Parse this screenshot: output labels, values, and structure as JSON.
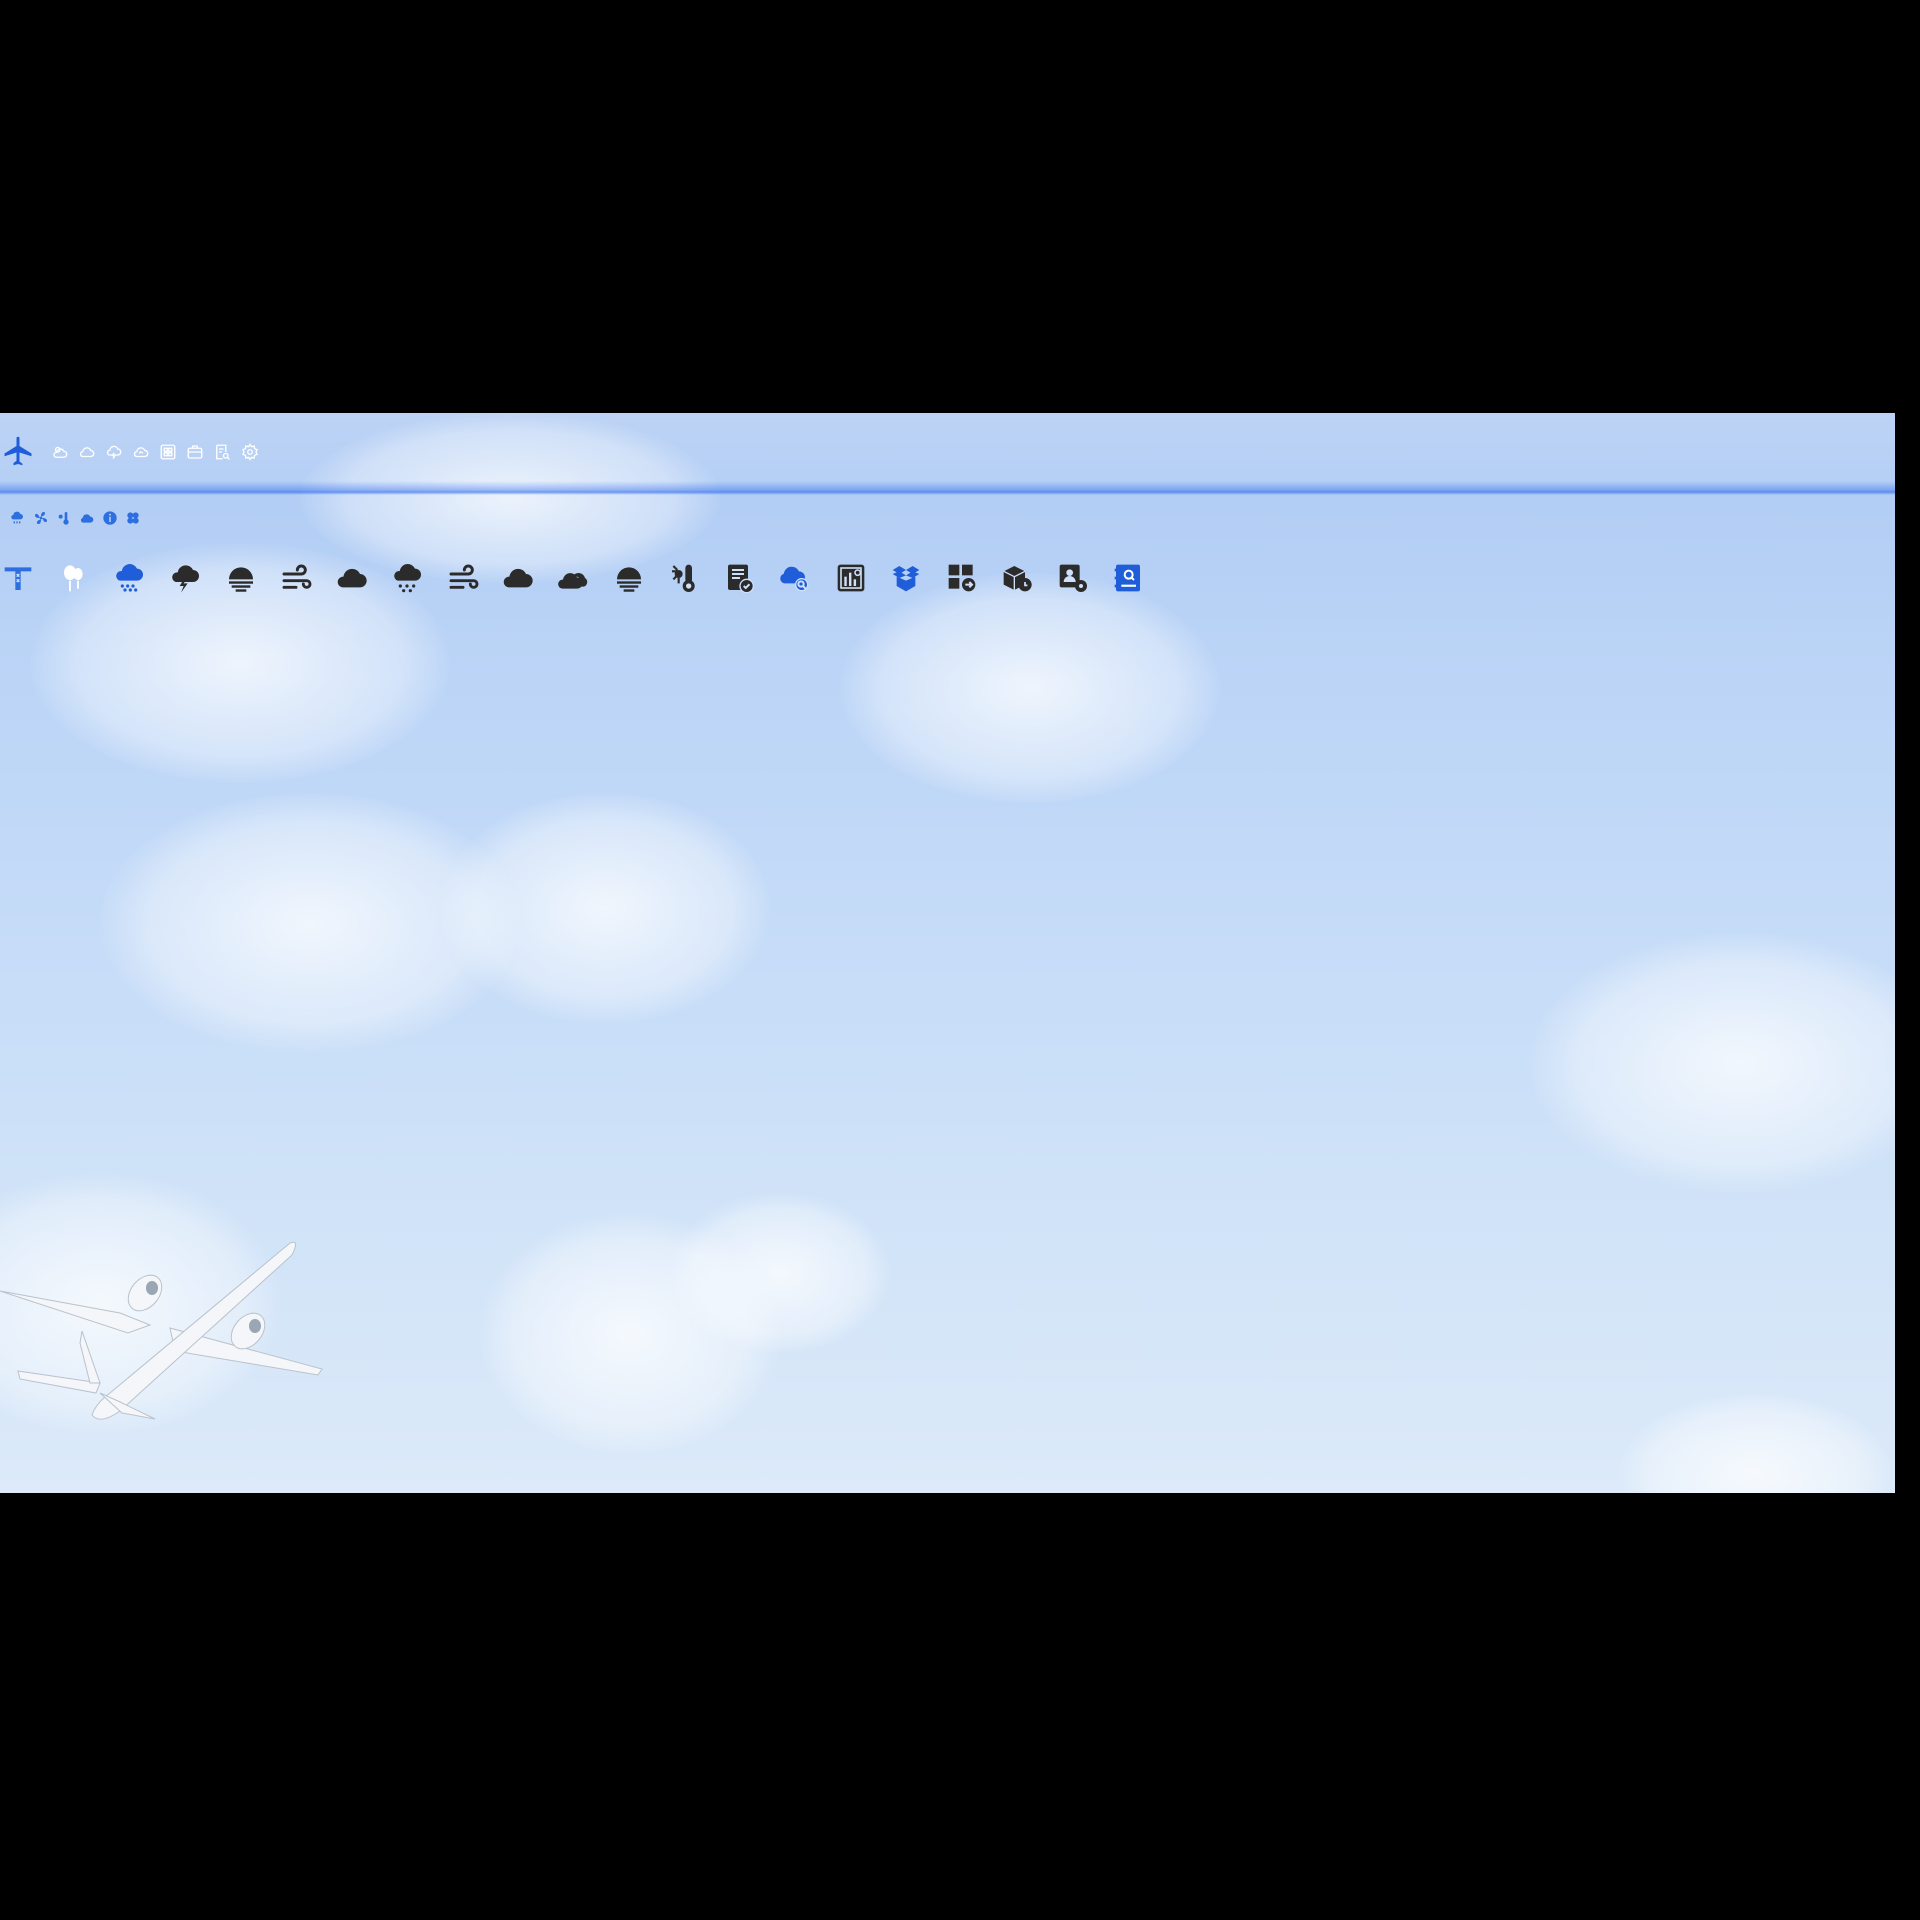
{
  "colors": {
    "accent_blue": "#1f5ed8",
    "toolbar_icon": "#ffffff",
    "dark_icon": "#2b2b2b",
    "sky_top": "#aecaf3",
    "sky_bottom": "#dceaf9"
  },
  "toolbar": {
    "logo_icon": "airplane-icon",
    "icons": [
      "cloudy-sun-icon",
      "cloud-outline-icon",
      "thunder-cloud-icon",
      "partly-cloudy-icon",
      "grid-icon",
      "briefcase-icon",
      "document-search-icon",
      "settings-gear-icon"
    ]
  },
  "small_row": {
    "icons": [
      "rain-cloud-icon",
      "fan-icon",
      "sun-thermometer-icon",
      "cloud-icon",
      "info-circle-icon",
      "clover-icon"
    ]
  },
  "large_row": {
    "icons": [
      "crane-tower-icon",
      "balloon-icon",
      "rain-cloud-blue-icon",
      "thunderstorm-icon",
      "haze-sun-icon",
      "wind-icon",
      "cloud-icon",
      "rain-icon",
      "wind-icon-2",
      "cloud-icon-2",
      "double-cloud-icon",
      "haze-sun-icon-2",
      "hot-thermometer-icon",
      "report-check-icon",
      "cloud-search-icon",
      "chart-board-icon",
      "open-box-icon",
      "apps-export-icon",
      "package-clock-icon",
      "user-settings-icon",
      "address-book-icon"
    ]
  }
}
